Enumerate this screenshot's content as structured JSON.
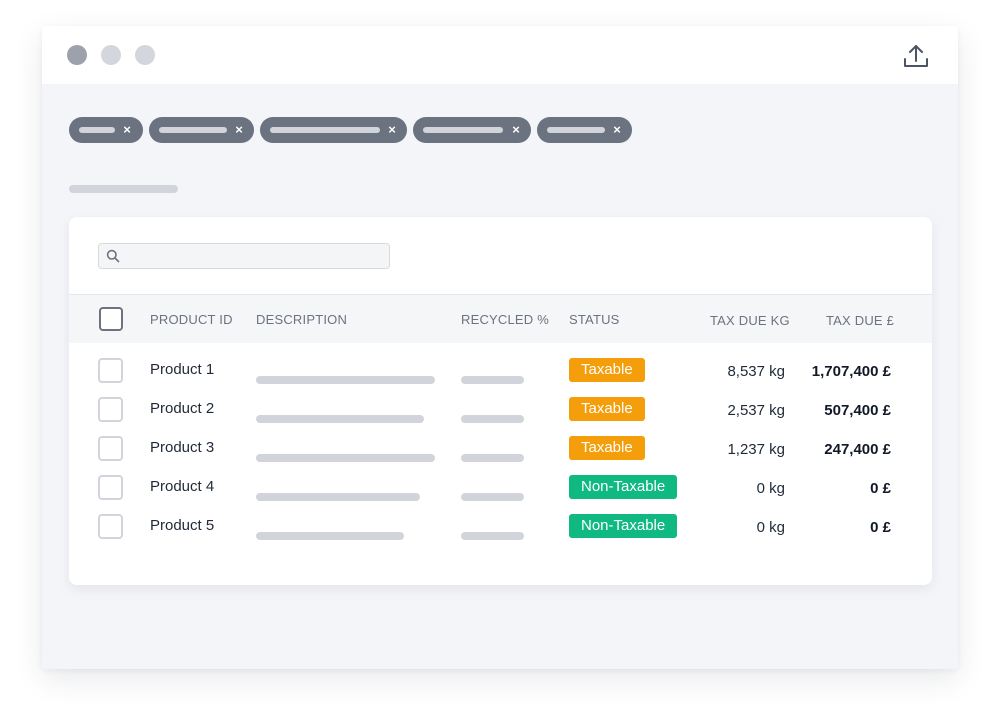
{
  "window": {
    "controls": [
      "close",
      "minimize",
      "maximize"
    ],
    "upload_icon": "upload-icon"
  },
  "filters": {
    "chips": [
      {
        "remove_label": "×"
      },
      {
        "remove_label": "×"
      },
      {
        "remove_label": "×"
      },
      {
        "remove_label": "×"
      },
      {
        "remove_label": "×"
      }
    ]
  },
  "search": {
    "icon": "search-icon",
    "value": "",
    "placeholder": ""
  },
  "table": {
    "columns": {
      "product_id": "PRODUCT ID",
      "description": "DESCRIPTION",
      "recycled": "RECYCLED %",
      "status": "STATUS",
      "tax_kg": "TAX DUE KG",
      "tax_gbp": "TAX DUE £"
    },
    "rows": [
      {
        "product": "Product 1",
        "status": "Taxable",
        "tax_kg": "8,537 kg",
        "tax_gbp": "1,707,400 £"
      },
      {
        "product": "Product 2",
        "status": "Taxable",
        "tax_kg": "2,537 kg",
        "tax_gbp": "507,400 £"
      },
      {
        "product": "Product 3",
        "status": "Taxable",
        "tax_kg": "1,237 kg",
        "tax_gbp": "247,400 £"
      },
      {
        "product": "Product 4",
        "status": "Non-Taxable",
        "tax_kg": "0 kg",
        "tax_gbp": "0 £"
      },
      {
        "product": "Product 5",
        "status": "Non-Taxable",
        "tax_kg": "0 kg",
        "tax_gbp": "0 £"
      }
    ]
  },
  "colors": {
    "taxable": "#f59e0b",
    "non_taxable": "#10b981",
    "chip": "#6b7280"
  }
}
